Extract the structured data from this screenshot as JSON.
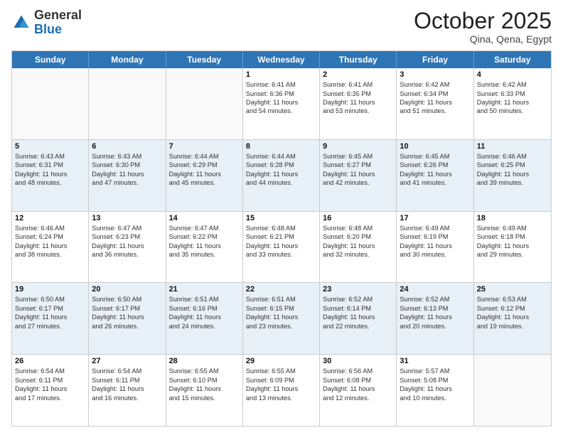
{
  "logo": {
    "general": "General",
    "blue": "Blue"
  },
  "header": {
    "month": "October 2025",
    "location": "Qina, Qena, Egypt"
  },
  "days": [
    "Sunday",
    "Monday",
    "Tuesday",
    "Wednesday",
    "Thursday",
    "Friday",
    "Saturday"
  ],
  "rows": [
    [
      {
        "day": "",
        "lines": [],
        "empty": true
      },
      {
        "day": "",
        "lines": [],
        "empty": true
      },
      {
        "day": "",
        "lines": [],
        "empty": true
      },
      {
        "day": "1",
        "lines": [
          "Sunrise: 6:41 AM",
          "Sunset: 6:36 PM",
          "Daylight: 11 hours",
          "and 54 minutes."
        ]
      },
      {
        "day": "2",
        "lines": [
          "Sunrise: 6:41 AM",
          "Sunset: 6:35 PM",
          "Daylight: 11 hours",
          "and 53 minutes."
        ]
      },
      {
        "day": "3",
        "lines": [
          "Sunrise: 6:42 AM",
          "Sunset: 6:34 PM",
          "Daylight: 11 hours",
          "and 51 minutes."
        ]
      },
      {
        "day": "4",
        "lines": [
          "Sunrise: 6:42 AM",
          "Sunset: 6:33 PM",
          "Daylight: 11 hours",
          "and 50 minutes."
        ]
      }
    ],
    [
      {
        "day": "5",
        "lines": [
          "Sunrise: 6:43 AM",
          "Sunset: 6:31 PM",
          "Daylight: 11 hours",
          "and 48 minutes."
        ]
      },
      {
        "day": "6",
        "lines": [
          "Sunrise: 6:43 AM",
          "Sunset: 6:30 PM",
          "Daylight: 11 hours",
          "and 47 minutes."
        ]
      },
      {
        "day": "7",
        "lines": [
          "Sunrise: 6:44 AM",
          "Sunset: 6:29 PM",
          "Daylight: 11 hours",
          "and 45 minutes."
        ]
      },
      {
        "day": "8",
        "lines": [
          "Sunrise: 6:44 AM",
          "Sunset: 6:28 PM",
          "Daylight: 11 hours",
          "and 44 minutes."
        ]
      },
      {
        "day": "9",
        "lines": [
          "Sunrise: 6:45 AM",
          "Sunset: 6:27 PM",
          "Daylight: 11 hours",
          "and 42 minutes."
        ]
      },
      {
        "day": "10",
        "lines": [
          "Sunrise: 6:45 AM",
          "Sunset: 6:26 PM",
          "Daylight: 11 hours",
          "and 41 minutes."
        ]
      },
      {
        "day": "11",
        "lines": [
          "Sunrise: 6:46 AM",
          "Sunset: 6:25 PM",
          "Daylight: 11 hours",
          "and 39 minutes."
        ]
      }
    ],
    [
      {
        "day": "12",
        "lines": [
          "Sunrise: 6:46 AM",
          "Sunset: 6:24 PM",
          "Daylight: 11 hours",
          "and 38 minutes."
        ]
      },
      {
        "day": "13",
        "lines": [
          "Sunrise: 6:47 AM",
          "Sunset: 6:23 PM",
          "Daylight: 11 hours",
          "and 36 minutes."
        ]
      },
      {
        "day": "14",
        "lines": [
          "Sunrise: 6:47 AM",
          "Sunset: 6:22 PM",
          "Daylight: 11 hours",
          "and 35 minutes."
        ]
      },
      {
        "day": "15",
        "lines": [
          "Sunrise: 6:48 AM",
          "Sunset: 6:21 PM",
          "Daylight: 11 hours",
          "and 33 minutes."
        ]
      },
      {
        "day": "16",
        "lines": [
          "Sunrise: 6:48 AM",
          "Sunset: 6:20 PM",
          "Daylight: 11 hours",
          "and 32 minutes."
        ]
      },
      {
        "day": "17",
        "lines": [
          "Sunrise: 6:49 AM",
          "Sunset: 6:19 PM",
          "Daylight: 11 hours",
          "and 30 minutes."
        ]
      },
      {
        "day": "18",
        "lines": [
          "Sunrise: 6:49 AM",
          "Sunset: 6:18 PM",
          "Daylight: 11 hours",
          "and 29 minutes."
        ]
      }
    ],
    [
      {
        "day": "19",
        "lines": [
          "Sunrise: 6:50 AM",
          "Sunset: 6:17 PM",
          "Daylight: 11 hours",
          "and 27 minutes."
        ]
      },
      {
        "day": "20",
        "lines": [
          "Sunrise: 6:50 AM",
          "Sunset: 6:17 PM",
          "Daylight: 11 hours",
          "and 26 minutes."
        ]
      },
      {
        "day": "21",
        "lines": [
          "Sunrise: 6:51 AM",
          "Sunset: 6:16 PM",
          "Daylight: 11 hours",
          "and 24 minutes."
        ]
      },
      {
        "day": "22",
        "lines": [
          "Sunrise: 6:51 AM",
          "Sunset: 6:15 PM",
          "Daylight: 11 hours",
          "and 23 minutes."
        ]
      },
      {
        "day": "23",
        "lines": [
          "Sunrise: 6:52 AM",
          "Sunset: 6:14 PM",
          "Daylight: 11 hours",
          "and 22 minutes."
        ]
      },
      {
        "day": "24",
        "lines": [
          "Sunrise: 6:52 AM",
          "Sunset: 6:13 PM",
          "Daylight: 11 hours",
          "and 20 minutes."
        ]
      },
      {
        "day": "25",
        "lines": [
          "Sunrise: 6:53 AM",
          "Sunset: 6:12 PM",
          "Daylight: 11 hours",
          "and 19 minutes."
        ]
      }
    ],
    [
      {
        "day": "26",
        "lines": [
          "Sunrise: 6:54 AM",
          "Sunset: 6:11 PM",
          "Daylight: 11 hours",
          "and 17 minutes."
        ]
      },
      {
        "day": "27",
        "lines": [
          "Sunrise: 6:54 AM",
          "Sunset: 6:11 PM",
          "Daylight: 11 hours",
          "and 16 minutes."
        ]
      },
      {
        "day": "28",
        "lines": [
          "Sunrise: 6:55 AM",
          "Sunset: 6:10 PM",
          "Daylight: 11 hours",
          "and 15 minutes."
        ]
      },
      {
        "day": "29",
        "lines": [
          "Sunrise: 6:55 AM",
          "Sunset: 6:09 PM",
          "Daylight: 11 hours",
          "and 13 minutes."
        ]
      },
      {
        "day": "30",
        "lines": [
          "Sunrise: 6:56 AM",
          "Sunset: 6:08 PM",
          "Daylight: 11 hours",
          "and 12 minutes."
        ]
      },
      {
        "day": "31",
        "lines": [
          "Sunrise: 5:57 AM",
          "Sunset: 5:08 PM",
          "Daylight: 11 hours",
          "and 10 minutes."
        ]
      },
      {
        "day": "",
        "lines": [],
        "empty": true
      }
    ]
  ]
}
